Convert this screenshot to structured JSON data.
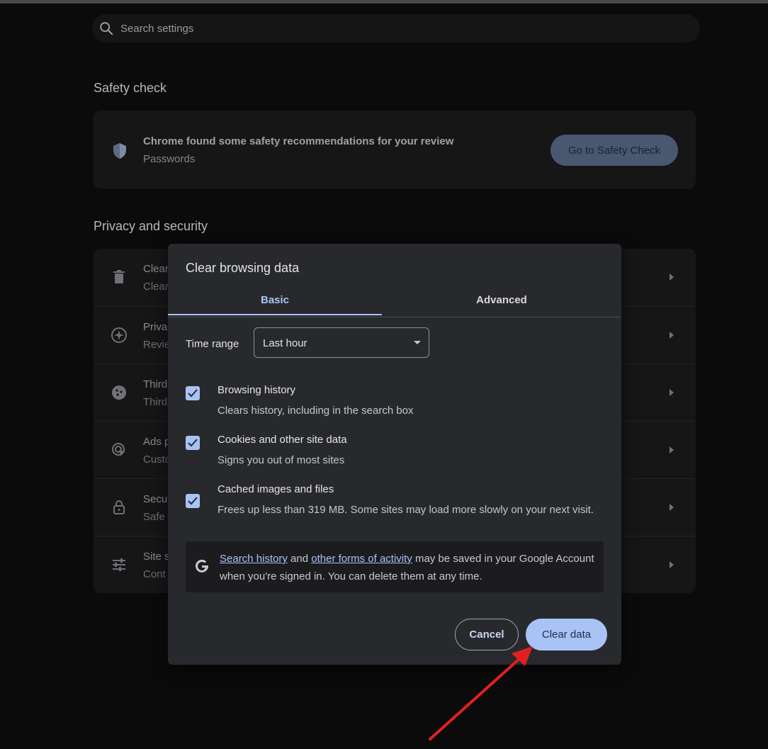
{
  "search": {
    "placeholder": "Search settings"
  },
  "safety_check": {
    "section_title": "Safety check",
    "title": "Chrome found some safety recommendations for your review",
    "subtitle": "Passwords",
    "button_label": "Go to Safety Check"
  },
  "privacy": {
    "section_title": "Privacy and security",
    "rows": [
      {
        "title": "Clear",
        "subtitle": "Clear",
        "icon": "trash-icon"
      },
      {
        "title": "Priva",
        "subtitle": "Revie",
        "icon": "compass-icon"
      },
      {
        "title": "Third",
        "subtitle": "Third",
        "icon": "cookie-icon"
      },
      {
        "title": "Ads p",
        "subtitle": "Custo",
        "icon": "ads-icon"
      },
      {
        "title": "Secu",
        "subtitle": "Safe",
        "icon": "lock-icon"
      },
      {
        "title": "Site s",
        "subtitle": "Cont",
        "icon": "sliders-icon"
      }
    ]
  },
  "dialog": {
    "title": "Clear browsing data",
    "tabs": [
      {
        "label": "Basic",
        "active": true
      },
      {
        "label": "Advanced",
        "active": false
      }
    ],
    "time_range": {
      "label": "Time range",
      "value": "Last hour"
    },
    "options": [
      {
        "title": "Browsing history",
        "subtitle": "Clears history, including in the search box",
        "checked": true
      },
      {
        "title": "Cookies and other site data",
        "subtitle": "Signs you out of most sites",
        "checked": true
      },
      {
        "title": "Cached images and files",
        "subtitle": "Frees up less than 319 MB. Some sites may load more slowly on your next visit.",
        "checked": true
      }
    ],
    "info": {
      "link1": "Search history",
      "text1": " and ",
      "link2": "other forms of activity",
      "text2": " may be saved in your Google Account when you're signed in. You can delete them at any time."
    },
    "cancel_label": "Cancel",
    "clear_label": "Clear data"
  },
  "colors": {
    "accent": "#a9c3f7",
    "annotation_arrow": "#e02020",
    "dialog_bg": "#28292c",
    "page_bg": "#0b0b0b"
  }
}
